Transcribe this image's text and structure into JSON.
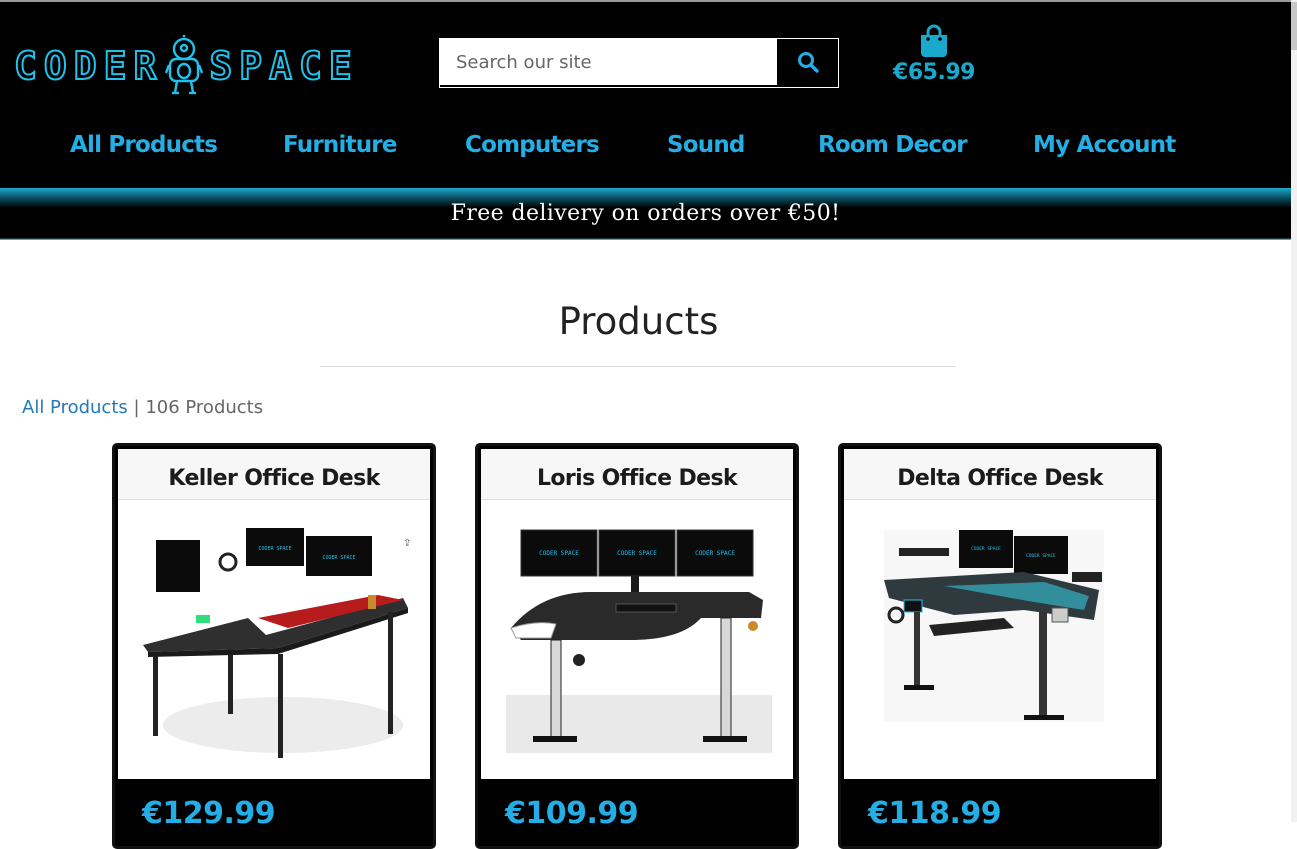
{
  "brand": {
    "logo_left": "CODER",
    "logo_right": "SPACE"
  },
  "search": {
    "placeholder": "Search our site"
  },
  "cart": {
    "total": "€65.99"
  },
  "nav": [
    "All Products",
    "Furniture",
    "Computers",
    "Sound",
    "Room Decor",
    "My Account"
  ],
  "banner": {
    "text": "Free delivery on orders over €50!"
  },
  "page": {
    "title": "Products",
    "breadcrumb_link": "All Products",
    "separator": "|",
    "count": "106 Products"
  },
  "products": [
    {
      "name": "Keller Office Desk",
      "price": "€129.99"
    },
    {
      "name": "Loris Office Desk",
      "price": "€109.99"
    },
    {
      "name": "Delta Office Desk",
      "price": "€118.99"
    }
  ],
  "monitor_text": "CODER SPACE",
  "colors": {
    "accent": "#23aee6",
    "header_bg": "#000000",
    "banner_glow": "#6cdcf5"
  }
}
